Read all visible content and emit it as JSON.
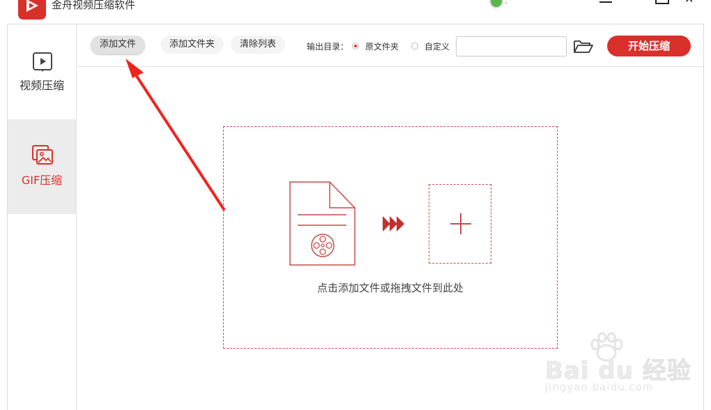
{
  "app": {
    "title": "金舟视频压缩软件",
    "status_text": ".",
    "accent_color": "#d9302c",
    "close_glyph": "✕"
  },
  "sidebar": {
    "items": [
      {
        "label": "视频压缩",
        "icon": "play-icon",
        "active": false
      },
      {
        "label": "GIF压缩",
        "icon": "image-icon",
        "active": true
      }
    ]
  },
  "toolbar": {
    "add_file": "添加文件",
    "add_folder": "添加文件夹",
    "clear_list": "清除列表",
    "output_label": "输出目录：",
    "option_original": "原文件夹",
    "option_custom": "自定义",
    "output_path_value": "",
    "start_button": "开始压缩"
  },
  "drop_zone": {
    "hint": "点击添加文件或拖拽文件到此处"
  },
  "watermark": {
    "brand": "Bai du 经验",
    "site": "jingyan.baidu.com"
  }
}
